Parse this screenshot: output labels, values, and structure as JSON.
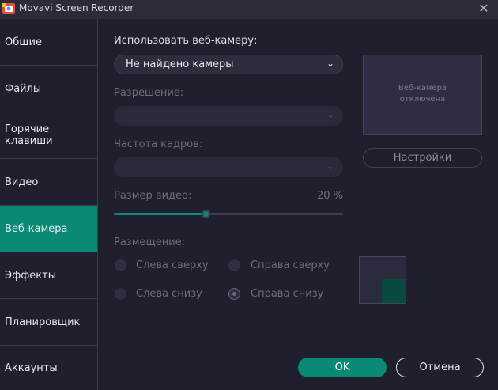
{
  "window": {
    "title": "Movavi Screen Recorder",
    "close_icon": "close-icon"
  },
  "sidebar": {
    "items": [
      {
        "label": "Общие"
      },
      {
        "label": "Файлы"
      },
      {
        "label": "Горячие\nклавиши"
      },
      {
        "label": "Видео"
      },
      {
        "label": "Веб-камера",
        "active": true
      },
      {
        "label": "Эффекты"
      },
      {
        "label": "Планировщик"
      },
      {
        "label": "Аккаунты"
      }
    ]
  },
  "webcam": {
    "use_label": "Использовать веб-камеру:",
    "camera_value": "Не найдено камеры",
    "resolution_label": "Разрешение:",
    "resolution_value": "",
    "framerate_label": "Частота кадров:",
    "framerate_value": "",
    "size_label": "Размер видео:",
    "size_value": "20 %",
    "size_percent": 20,
    "placement_label": "Размещение:",
    "positions": [
      {
        "label": "Слева сверху",
        "checked": false
      },
      {
        "label": "Справа сверху",
        "checked": false
      },
      {
        "label": "Слева снизу",
        "checked": false
      },
      {
        "label": "Справа снизу",
        "checked": true
      }
    ],
    "preview_text": "Веб-камера\nотключена",
    "settings_label": "Настройки"
  },
  "footer": {
    "ok_label": "OK",
    "cancel_label": "Отмена"
  },
  "colors": {
    "accent": "#0a8a75",
    "background": "#1f1f2e",
    "titlebar": "#2b2c3a"
  }
}
